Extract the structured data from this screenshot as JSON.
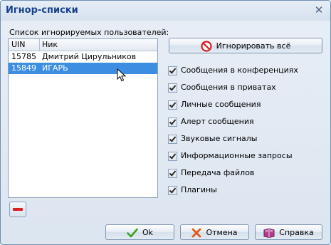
{
  "window": {
    "title": "Игнор-списки",
    "close_icon": "close-icon"
  },
  "list": {
    "label": "Список игнорируемых пользователей:",
    "columns": [
      "UIN",
      "Ник"
    ],
    "rows": [
      {
        "uin": "15785",
        "nick": "Дмитрий Цирульников",
        "selected": false
      },
      {
        "uin": "15849",
        "nick": "ИГАРЬ",
        "selected": true
      }
    ]
  },
  "buttons": {
    "ignore_all": "Игнорировать всё",
    "ok": "Ok",
    "cancel": "Отмена",
    "help": "Справка"
  },
  "options": [
    {
      "label": "Сообщения в конференциях",
      "checked": true
    },
    {
      "label": "Сообщения в приватах",
      "checked": true
    },
    {
      "label": "Личные сообщения",
      "checked": true
    },
    {
      "label": "Алерт сообщения",
      "checked": true
    },
    {
      "label": "Звуковые сигналы",
      "checked": true
    },
    {
      "label": "Информационные запросы",
      "checked": true
    },
    {
      "label": "Передача файлов",
      "checked": true
    },
    {
      "label": "Плагины",
      "checked": true
    }
  ],
  "colors": {
    "selection": "#3d8ee3",
    "title_text": "#15428b",
    "accent_red": "#e02020"
  }
}
